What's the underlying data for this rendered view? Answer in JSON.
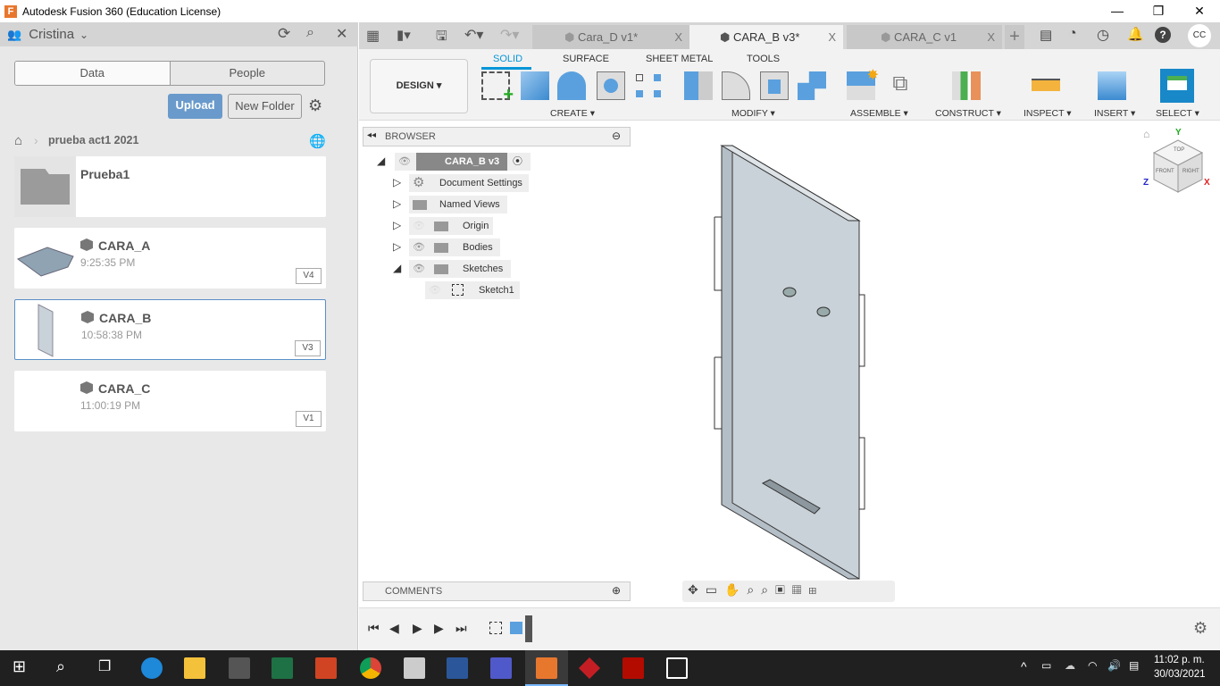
{
  "window": {
    "title": "Autodesk Fusion 360 (Education License)",
    "logo": "F",
    "minimize": "—",
    "maximize": "❐",
    "close": "✕"
  },
  "data_panel": {
    "user": "Cristina",
    "tabs": [
      "Data",
      "People"
    ],
    "upload": "Upload",
    "new_folder": "New Folder",
    "breadcrumb": "prueba act1 2021",
    "items": [
      {
        "name": "Prueba1",
        "type": "folder"
      },
      {
        "name": "CARA_A",
        "time": "9:25:35 PM",
        "version": "V4"
      },
      {
        "name": "CARA_B",
        "time": "10:58:38 PM",
        "version": "V3",
        "selected": true
      },
      {
        "name": "CARA_C",
        "time": "11:00:19 PM",
        "version": "V1"
      }
    ]
  },
  "doc_tabs": [
    {
      "label": "Cara_D v1*",
      "active": false
    },
    {
      "label": "CARA_B v3*",
      "active": true
    },
    {
      "label": "CARA_C v1",
      "active": false
    }
  ],
  "user_initials": "CC",
  "toolbar": {
    "workspace": "DESIGN ▾",
    "tabs": [
      "SOLID",
      "SURFACE",
      "SHEET METAL",
      "TOOLS"
    ],
    "active_tab": "SOLID",
    "groups": [
      "CREATE ▾",
      "MODIFY ▾",
      "ASSEMBLE ▾",
      "CONSTRUCT ▾",
      "INSPECT ▾",
      "INSERT ▾",
      "SELECT ▾"
    ]
  },
  "browser": {
    "title": "BROWSER",
    "root": "CARA_B v3",
    "nodes": [
      "Document Settings",
      "Named Views",
      "Origin",
      "Bodies",
      "Sketches",
      "Sketch1"
    ]
  },
  "comments": {
    "title": "COMMENTS"
  },
  "viewcube": {
    "faces": [
      "TOP",
      "FRONT",
      "RIGHT"
    ],
    "axes": [
      "Y",
      "Z",
      "X"
    ]
  },
  "taskbar": {
    "time": "11:02 p. m.",
    "date": "30/03/2021"
  },
  "colors": {
    "accent": "#0696d7",
    "upload": "#6a9acb",
    "plate": "#c9d2d8"
  }
}
